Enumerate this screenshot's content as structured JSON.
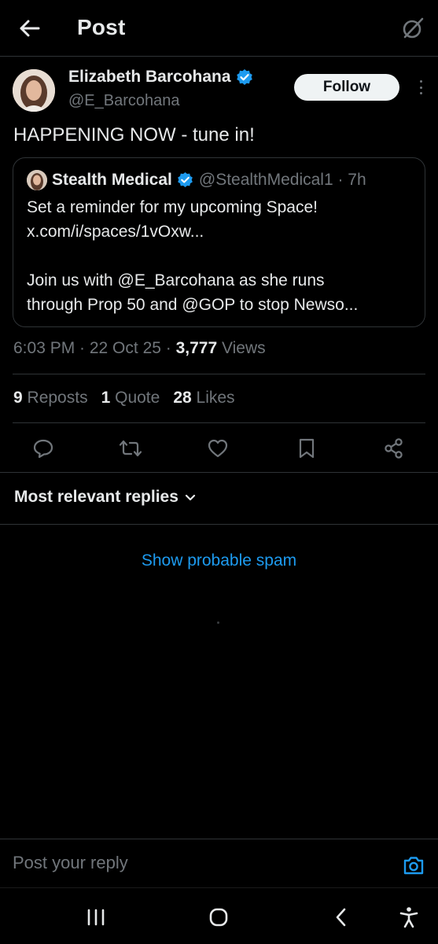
{
  "header": {
    "title": "Post",
    "back_icon": "arrow-left-icon",
    "grok_icon": "grok-icon"
  },
  "post": {
    "author_name": "Elizabeth Barcohana",
    "author_handle": "@E_Barcohana",
    "verified": true,
    "follow_label": "Follow",
    "text": "HAPPENING NOW - tune in!",
    "timestamp": "6:03 PM · 22 Oct 25 · ",
    "views_count": "3,777",
    "views_label": " Views"
  },
  "quote": {
    "name": "Stealth Medical",
    "handle_time": "@StealthMedical1 · 7h",
    "line1": "Set a reminder for my upcoming Space!",
    "line2": "x.com/i/spaces/1vOxw...",
    "line3": "Join us with @E_Barcohana as she runs",
    "line4": "through Prop 50 and @GOP to stop Newso..."
  },
  "stats": {
    "reposts_count": "9",
    "reposts_label": "Reposts",
    "quotes_count": "1",
    "quotes_label": "Quote",
    "likes_count": "28",
    "likes_label": "Likes"
  },
  "replies": {
    "sort_label": "Most relevant replies",
    "spam_link": "Show probable spam"
  },
  "reply_bar": {
    "placeholder": "Post your reply"
  },
  "colors": {
    "background": "#000000",
    "text": "#e7e9ea",
    "muted": "#71767b",
    "accent": "#1d9bf0",
    "border": "#2f3336"
  }
}
